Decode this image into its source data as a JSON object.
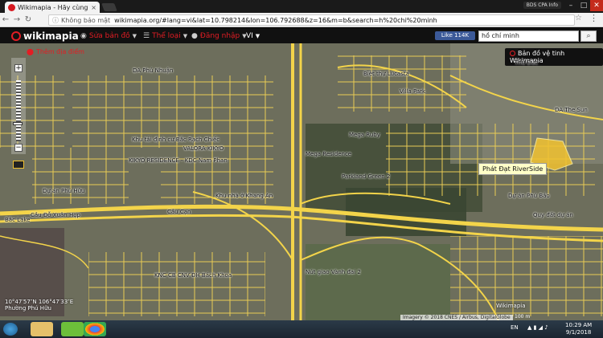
{
  "browser": {
    "tab_title": "Wikimapia - Hãy cùng nh...",
    "profile_label": "BDS CPA Info",
    "security_text": "Không bảo mật",
    "url": "wikimapia.org/#lang=vi&lat=10.798214&lon=106.792688&z=16&m=b&search=h%20chi%20minh"
  },
  "header": {
    "logo": "wikimapia",
    "edit_map": "Sửa bản đồ",
    "categories": "Thể loại",
    "login": "Đăng nhập",
    "lang": "VI",
    "fb_like": "Like 114K",
    "search_value": "hồ chí minh"
  },
  "map": {
    "add_place": "Thêm địa điểm",
    "satellite_button": "Bản đồ vệ tinh Wikimapia",
    "tooltip": "Phát Đạt RiverSide",
    "labels": [
      {
        "text": "DA Phú Nhuận"
      },
      {
        "text": "Biệt thự Lucasta"
      },
      {
        "text": "Villa Park"
      },
      {
        "text": "Thủ Đức"
      },
      {
        "text": "DA The Sun"
      },
      {
        "text": "Mega Ruby"
      },
      {
        "text": "Mega Residence"
      },
      {
        "text": "Parkland Green 2"
      },
      {
        "text": "Khu tái định cư Bắc Rạch Chiếc"
      },
      {
        "text": "VALORA KIKYO"
      },
      {
        "text": "KIKYO RESIDENCE - KDC Nam Phan"
      },
      {
        "text": "Khu nhà ở Khang An"
      },
      {
        "text": "Dự án Phú Hữu"
      },
      {
        "text": "Quy đất dự án"
      },
      {
        "text": "Dự án Phú Bảo"
      },
      {
        "text": "Cầu Đỗ Xuân Hợp"
      },
      {
        "text": "Cầu Cạn"
      },
      {
        "text": "Nút giao Vành đai 2"
      },
      {
        "text": "KNC CB CNV ĐH Bách Khoa"
      },
      {
        "text": "Bắc Lake"
      }
    ],
    "coords": "10°47′57″N 106°47′33″E",
    "place": "Phường Phú Hữu",
    "wm_logo": "Wikimapia",
    "attribution": "Imagery © 2018 CNES / Airbus, DigitalGlobe",
    "scale": "100 m"
  },
  "taskbar": {
    "lang": "EN",
    "time": "10:29 AM",
    "date": "9/1/2018"
  },
  "colors": {
    "road": "#f3d44a",
    "brand": "#e31d24",
    "highlight": "#f2c230"
  }
}
